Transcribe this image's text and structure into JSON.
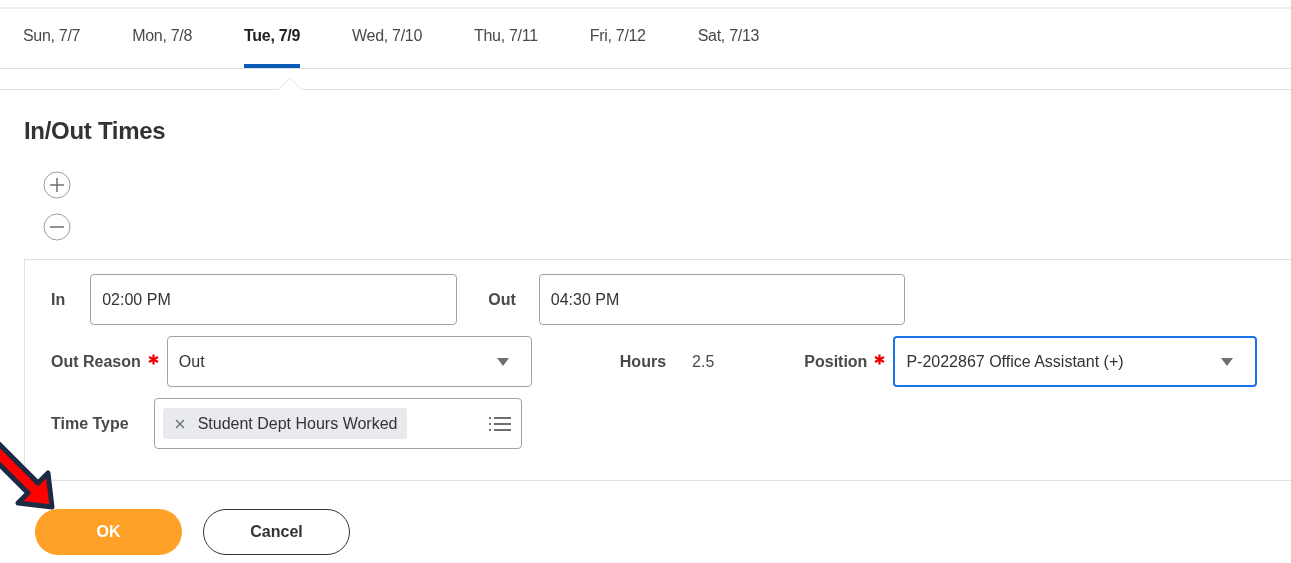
{
  "tabs": [
    {
      "label": "Sun, 7/7",
      "selected": false
    },
    {
      "label": "Mon, 7/8",
      "selected": false
    },
    {
      "label": "Tue, 7/9",
      "selected": true
    },
    {
      "label": "Wed, 7/10",
      "selected": false
    },
    {
      "label": "Thu, 7/11",
      "selected": false
    },
    {
      "label": "Fri, 7/12",
      "selected": false
    },
    {
      "label": "Sat, 7/13",
      "selected": false
    }
  ],
  "section_title": "In/Out Times",
  "rows": [
    [
      {
        "kind": "text",
        "label": "In",
        "required": false,
        "value": "02:00 PM",
        "focused": false
      },
      {
        "kind": "text",
        "label": "Out",
        "required": false,
        "value": "04:30 PM",
        "focused": false
      }
    ],
    [
      {
        "kind": "select",
        "label": "Out Reason",
        "required": true,
        "value": "Out",
        "focused": false
      },
      {
        "kind": "display",
        "label": "Hours",
        "required": false,
        "value": "2.5"
      },
      {
        "kind": "select",
        "label": "Position",
        "required": true,
        "value": "P-2022867 Office Assistant (+)",
        "focused": true
      }
    ],
    [
      {
        "kind": "multiselect",
        "label": "Time Type",
        "required": false,
        "value": "Student Dept Hours Worked",
        "focused": false
      }
    ]
  ],
  "buttons": [
    {
      "label": "OK",
      "kind": "primary"
    },
    {
      "label": "Cancel",
      "kind": "secondary"
    }
  ]
}
